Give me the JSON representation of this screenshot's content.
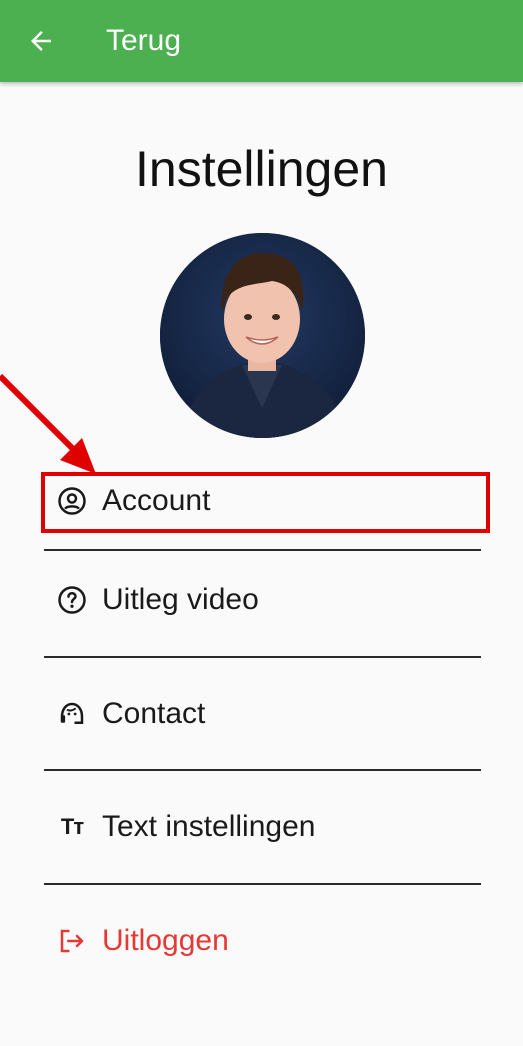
{
  "appbar": {
    "back_label": "Terug",
    "color": "#4caf50"
  },
  "page": {
    "title": "Instellingen"
  },
  "menu": [
    {
      "label": "Account",
      "icon": "account-circle-icon"
    },
    {
      "label": "Uitleg video",
      "icon": "help-circle-icon"
    },
    {
      "label": "Contact",
      "icon": "support-agent-icon"
    },
    {
      "label": "Text instellingen",
      "icon": "text-size-icon",
      "icon_glyph": "Tт"
    },
    {
      "label": "Uitloggen",
      "icon": "logout-icon",
      "color": "#e53935"
    }
  ],
  "annotation": {
    "highlight_color": "#e00000"
  }
}
